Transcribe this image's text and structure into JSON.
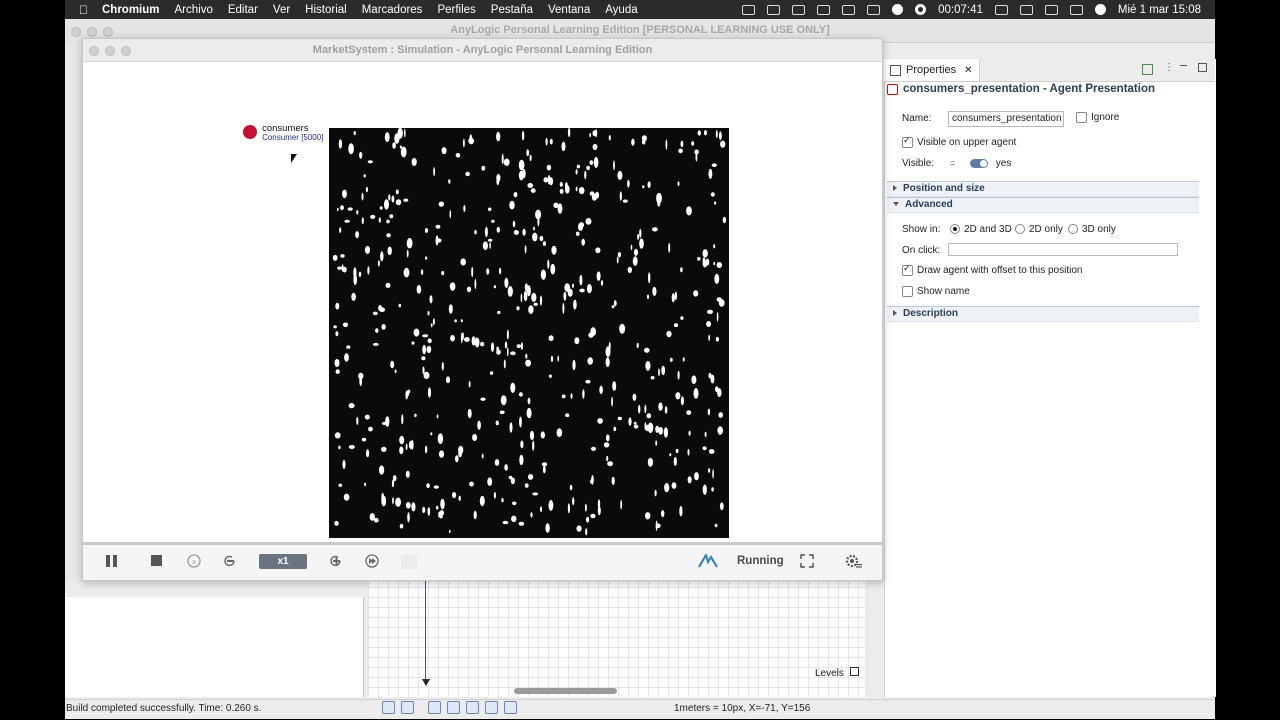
{
  "menubar": {
    "app": "Chromium",
    "items": [
      "Archivo",
      "Editar",
      "Ver",
      "Historial",
      "Marcadores",
      "Perfiles",
      "Pestaña",
      "Ventana",
      "Ayuda"
    ],
    "timer": "00:07:41",
    "datetime": "Mié 1 mar  15:08"
  },
  "ide": {
    "title": "AnyLogic Personal Learning Edition [PERSONAL LEARNING USE ONLY]",
    "levels_label": "Levels",
    "status_text": "Build completed successfully. Time: 0.260 s.",
    "coords_text": "1meters = 10px, X=-71, Y=156"
  },
  "simulation": {
    "title": "MarketSystem : Simulation - AnyLogic Personal Learning Edition",
    "legend_title": "consumers",
    "legend_subtitle": "Consumer [5000]",
    "speed": "x1",
    "status": "Running"
  },
  "properties": {
    "tab_label": "Properties",
    "header": "consumers_presentation - Agent Presentation",
    "name_label": "Name:",
    "name_value": "consumers_presentation",
    "ignore_label": "Ignore",
    "visible_upper_label": "Visible on upper agent",
    "visible_label": "Visible:",
    "visible_value": "yes",
    "section_position": "Position and size",
    "section_advanced": "Advanced",
    "show_in_label": "Show in:",
    "show_in_options": [
      "2D and 3D",
      "2D only",
      "3D only"
    ],
    "on_click_label": "On click:",
    "draw_offset_label": "Draw agent with offset to this position",
    "show_name_label": "Show name",
    "section_description": "Description"
  },
  "colors": {
    "menubar_bg": "#2b2b2e",
    "accent": "#2c3e57",
    "legend_icon": "#c8102e",
    "speed_bg": "#6a7480"
  }
}
